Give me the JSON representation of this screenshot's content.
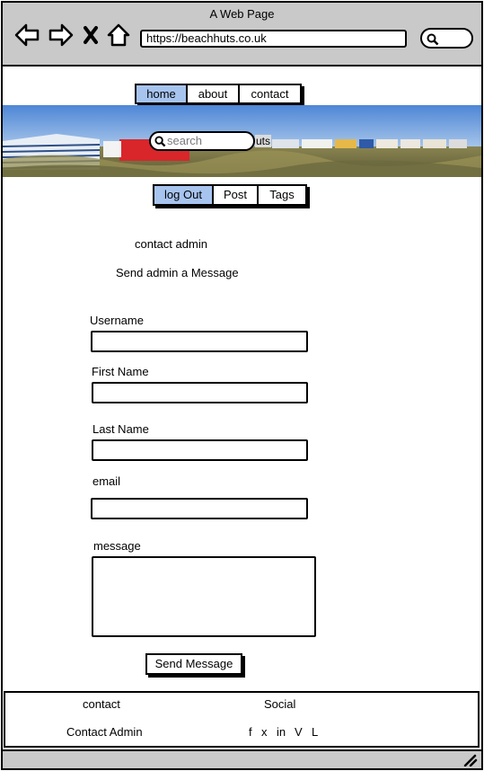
{
  "browser": {
    "title": "A Web Page",
    "url": "https://beachhuts.co.uk"
  },
  "top_nav": {
    "items": [
      {
        "label": "home",
        "active": true
      },
      {
        "label": "about",
        "active": false
      },
      {
        "label": "contact",
        "active": false
      }
    ]
  },
  "hero": {
    "search_placeholder": "search",
    "overlay_text": "uts"
  },
  "sub_nav": {
    "items": [
      {
        "label": "log Out",
        "active": true
      },
      {
        "label": "Post",
        "active": false
      },
      {
        "label": "Tags",
        "active": false
      }
    ]
  },
  "page": {
    "heading": "contact admin",
    "subheading": "Send admin a Message"
  },
  "form": {
    "username_label": "Username",
    "first_name_label": "First Name",
    "last_name_label": "Last Name",
    "email_label": "email",
    "message_label": "message",
    "submit_label": "Send Message"
  },
  "footer": {
    "contact_heading": "contact",
    "contact_link": "Contact Admin",
    "social_heading": "Social",
    "social_links": [
      "f",
      "x",
      "in",
      "V",
      "L"
    ]
  },
  "colors": {
    "chrome": "#c9c9c9",
    "active_tab": "#a7c4ef"
  },
  "icons": [
    "back-arrow-icon",
    "forward-arrow-icon",
    "close-icon",
    "home-icon",
    "search-icon",
    "resize-grip-icon"
  ]
}
